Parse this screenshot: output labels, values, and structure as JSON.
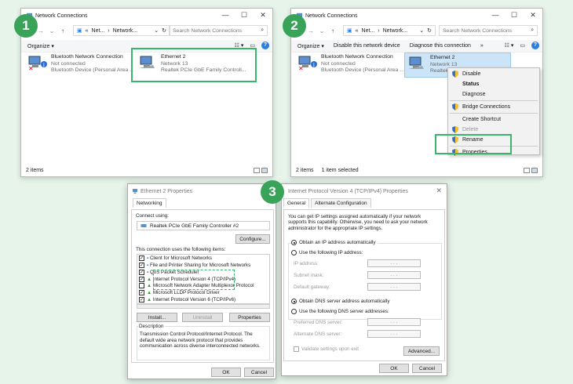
{
  "badges": [
    "1",
    "2",
    "3"
  ],
  "panel1": {
    "title": "Network Connections",
    "win_controls": [
      "—",
      "☐",
      "✕"
    ],
    "path_parts": [
      "Net...",
      "Network..."
    ],
    "search_placeholder": "Search Network Connections",
    "organize": "Organize ▾",
    "bt": {
      "name": "Bluetooth Network Connection",
      "status": "Not connected",
      "device": "Bluetooth Device (Personal Area ..."
    },
    "eth": {
      "name": "Ethernet 2",
      "status": "Network 13",
      "device": "Realtek PCIe GbE Family Controll..."
    },
    "status": "2 items"
  },
  "panel2": {
    "title": "Network Connections",
    "win_controls": [
      "—",
      "☐",
      "✕"
    ],
    "path_parts": [
      "Net...",
      "Network..."
    ],
    "search_placeholder": "Search Network Connections",
    "toolbar": [
      "Organize ▾",
      "Disable this network device",
      "Diagnose this connection",
      "»"
    ],
    "bt": {
      "name": "Bluetooth Network Connection",
      "status": "Not connected",
      "device": "Bluetooth Device (Personal Area ..."
    },
    "eth": {
      "name": "Ethernet 2",
      "status": "Network 13",
      "device": "Realtek"
    },
    "status_items": "2 items",
    "status_selected": "1 item selected",
    "menu": [
      "Disable",
      "Status",
      "Diagnose",
      "Bridge Connections",
      "Create Shortcut",
      "Delete",
      "Rename",
      "Properties"
    ]
  },
  "eth_props": {
    "title": "Ethernet 2 Properties",
    "tab": "Networking",
    "connect_using": "Connect using:",
    "adapter": "Realtek PCIe GbE Family Controller #2",
    "configure": "Configure...",
    "items_label": "This connection uses the following items:",
    "items": [
      {
        "label": "Client for Microsoft Networks",
        "checked": true
      },
      {
        "label": "File and Printer Sharing for Microsoft Networks",
        "checked": true
      },
      {
        "label": "QoS Packet Scheduler",
        "checked": true
      },
      {
        "label": "Internet Protocol Version 4 (TCP/IPv4)",
        "checked": true
      },
      {
        "label": "Microsoft Network Adapter Multiplexor Protocol",
        "checked": false
      },
      {
        "label": "Microsoft LLDP Protocol Driver",
        "checked": true
      },
      {
        "label": "Internet Protocol Version 6 (TCP/IPv6)",
        "checked": true
      }
    ],
    "install": "Install...",
    "uninstall": "Uninstall",
    "properties": "Properties",
    "desc_label": "Description",
    "desc_text": "Transmission Control Protocol/Internet Protocol. The default wide area network protocol that provides communication across diverse interconnected networks.",
    "ok": "OK",
    "cancel": "Cancel"
  },
  "ipv4": {
    "title": "Internet Protocol Version 4 (TCP/IPv4) Properties",
    "tabs": [
      "General",
      "Alternate Configuration"
    ],
    "intro": "You can get IP settings assigned automatically if your network supports this capability. Otherwise, you need to ask your network administrator for the appropriate IP settings.",
    "obtain_ip": "Obtain an IP address automatically",
    "use_ip": "Use the following IP address:",
    "ip_address": "IP address:",
    "subnet": "Subnet mask:",
    "gateway": "Default gateway:",
    "obtain_dns": "Obtain DNS server address automatically",
    "use_dns": "Use the following DNS server addresses:",
    "pref_dns": "Preferred DNS server:",
    "alt_dns": "Alternate DNS server:",
    "validate": "Validate settings upon exit",
    "advanced": "Advanced...",
    "ok": "OK",
    "cancel": "Cancel",
    "dots": ". . ."
  },
  "colors": {
    "highlight": "#3bb56a",
    "badge": "#3aa35a",
    "background": "#e6f4ea",
    "help": "#2a7de1"
  }
}
